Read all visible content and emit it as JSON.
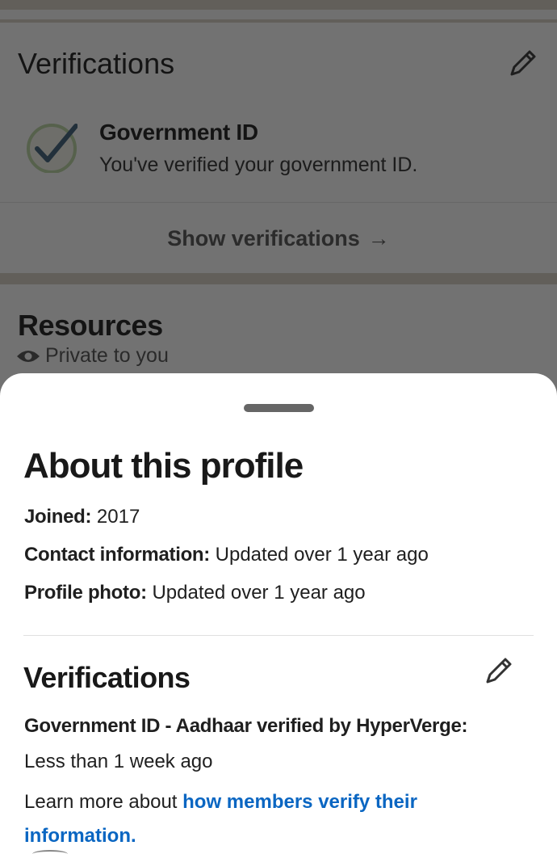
{
  "background": {
    "verifications_title": "Verifications",
    "gov_id_title": "Government ID",
    "gov_id_subtitle": "You've verified your government ID.",
    "show_verifications": "Show verifications",
    "show_arrow": "→",
    "resources_title": "Resources",
    "private_label": "Private to you"
  },
  "sheet": {
    "title": "About this profile",
    "joined_label": "Joined:",
    "joined_value": "2017",
    "contact_label": "Contact information:",
    "contact_value": "Updated over 1 year ago",
    "photo_label": "Profile photo:",
    "photo_value": "Updated over 1 year ago",
    "verifications_title": "Verifications",
    "gov_verification": "Government ID - Aadhaar verified by HyperVerge:",
    "gov_verification_time": "Less than 1 week ago",
    "learn_prefix": "Learn more about",
    "learn_link": "how members verify their information."
  },
  "icons": {
    "edit": "pencil-icon",
    "check": "check-circle-icon",
    "eye": "eye-icon"
  },
  "colors": {
    "link": "#0a66c2",
    "overlay": "#727272",
    "sheet": "#ffffff"
  }
}
